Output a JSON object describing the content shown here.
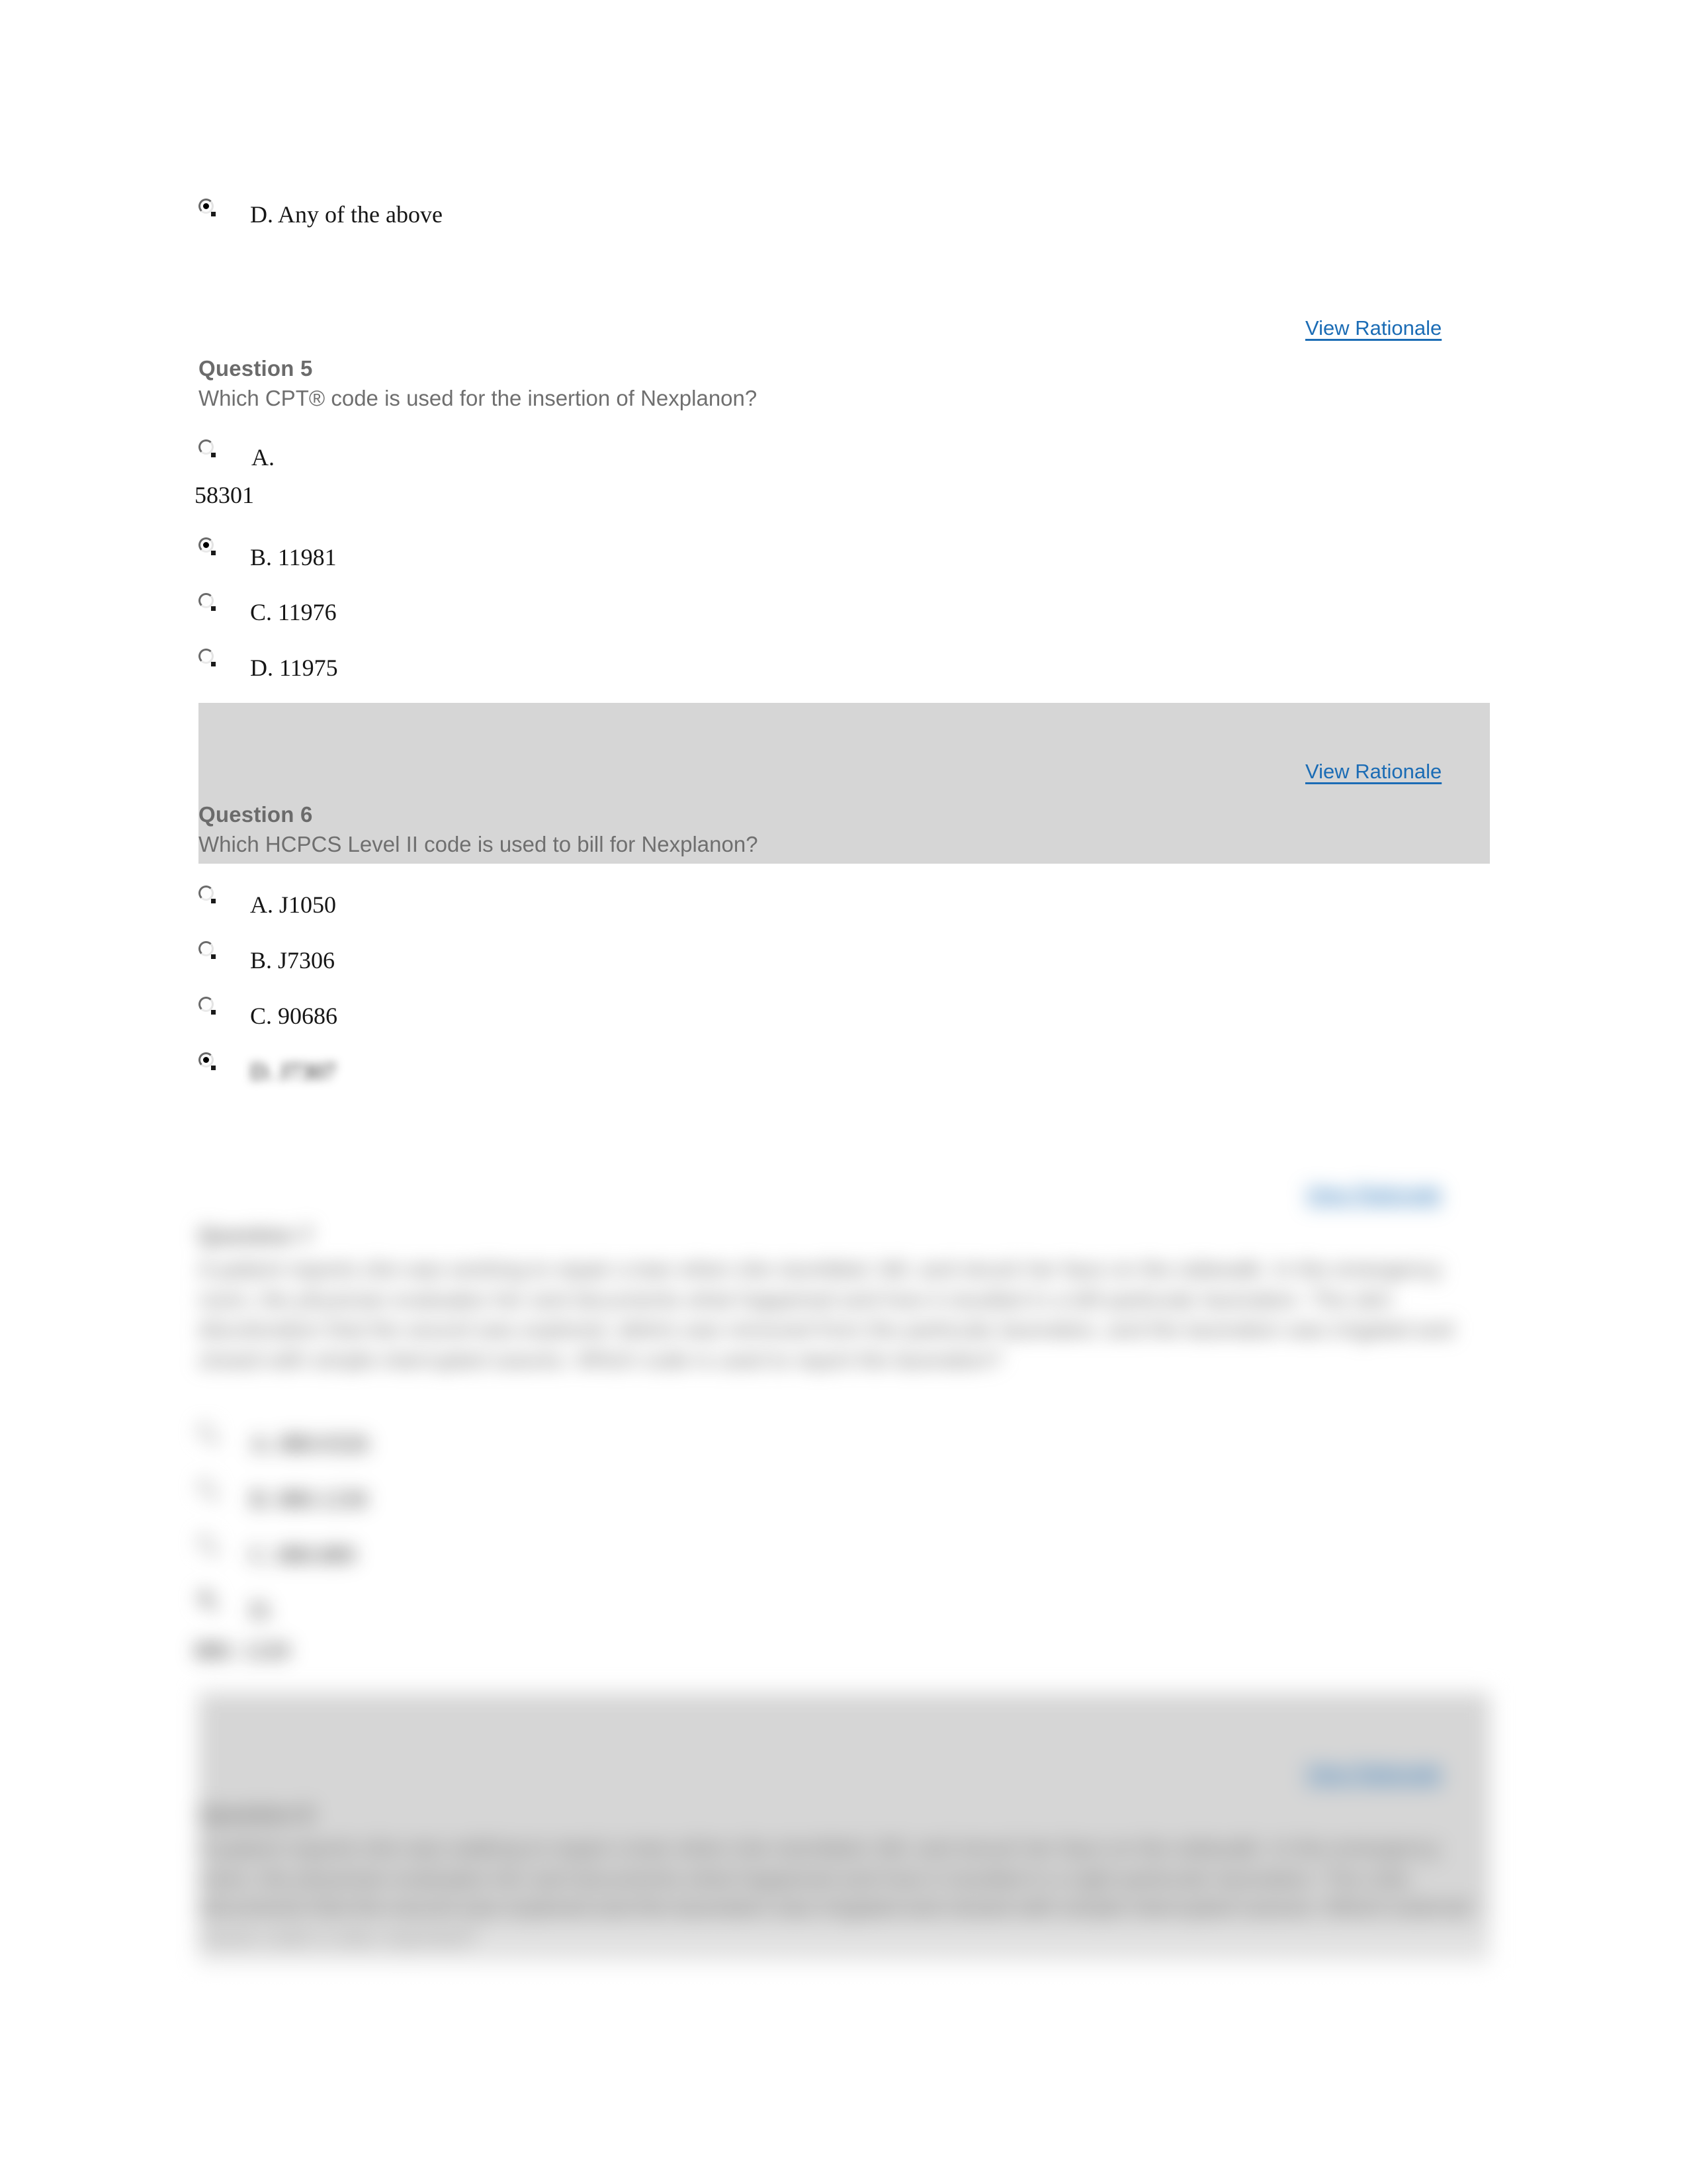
{
  "document": {
    "type": "online-quiz-review",
    "background_color": "#ffffff",
    "band_color": "#d6d6d6",
    "link_color": "#1b6cb5",
    "question_text_color": "#6f6f6f"
  },
  "previous_question_tail": {
    "option_label": "D. Any of the above",
    "selected": true
  },
  "rationale_link_label": "View Rationale",
  "questions": [
    {
      "number": "Question 5",
      "prompt": "Which CPT® code is used for the insertion of Nexplanon?",
      "shaded": false,
      "options": [
        {
          "label": "A.",
          "continuation": "58301",
          "selected": false
        },
        {
          "label": "B. 11981",
          "selected": true
        },
        {
          "label": "C. 11976",
          "selected": false
        },
        {
          "label": "D. 11975",
          "selected": false
        }
      ]
    },
    {
      "number": "Question 6",
      "prompt": "Which HCPCS Level II code is used to bill for Nexplanon?",
      "shaded": true,
      "options": [
        {
          "label": "A. J1050",
          "selected": false
        },
        {
          "label": "B. J7306",
          "selected": false
        },
        {
          "label": "C. 90686",
          "selected": false
        },
        {
          "label": "D. J7307",
          "selected": true
        }
      ]
    },
    {
      "number": "Question 7",
      "prompt": "A patient reports she was working to repair a tear when she stumbled, fell, and struck her face on the sidewalk. In the emergency room, the physician evaluates her and documents what happened and how it resulted in a left particular laceration. The skin discoloration that the wound was explored, debris was removed from the particular laceration, and the laceration was irrigated and closed with simple interrupted sutures. Which code is used to report the laceration?",
      "shaded": false,
      "blurred": true,
      "options": [
        {
          "label": "A. 880.0326",
          "selected": false
        },
        {
          "label": "B. 880.1230",
          "selected": false
        },
        {
          "label": "C. 880.889",
          "selected": false
        },
        {
          "label": "D.",
          "continuation": "880. 1220",
          "selected": true
        }
      ]
    },
    {
      "number": "Question 8",
      "prompt": "A patient reports she was walking to repair a tear when she stumbled, fell, and struck her face on the sidewalk. In the emergency room, the physician evaluates her and documents what happened and how it resulted in a right particular laceration. The note documents that the wound was explored and the laceration was irrigated and closed with simple interrupted sutures. Which external cause code is also reported?",
      "shaded": true,
      "blurred": true,
      "options": []
    }
  ]
}
